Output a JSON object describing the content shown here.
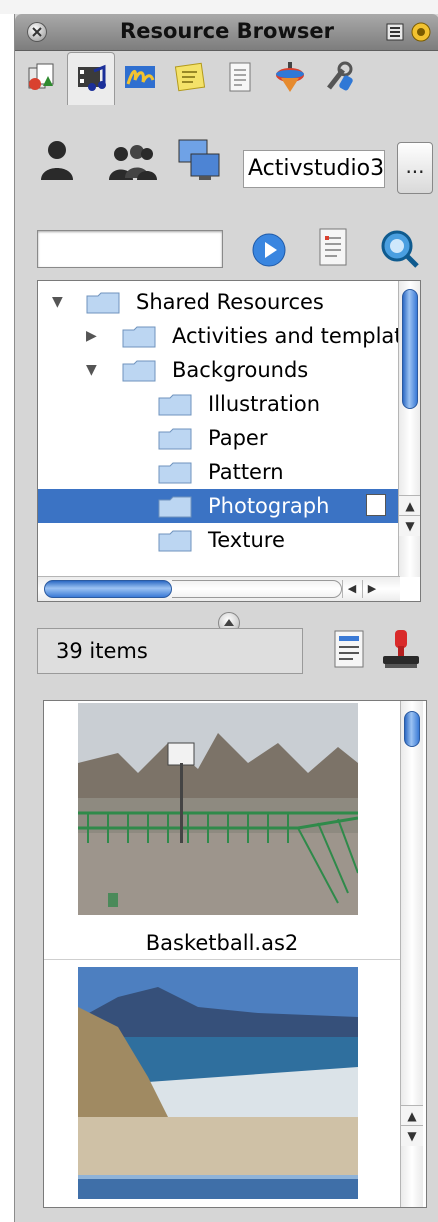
{
  "window": {
    "title": "Resource Browser"
  },
  "toolbar_tabs": [
    {
      "name": "resource-pack-tab",
      "icon": "shapes-icon"
    },
    {
      "name": "media-tab",
      "icon": "film-music-icon"
    },
    {
      "name": "handwriting-tab",
      "icon": "handwriting-icon"
    },
    {
      "name": "notes-tab",
      "icon": "sticky-note-icon"
    },
    {
      "name": "document-tab",
      "icon": "document-icon"
    },
    {
      "name": "spinner-tab",
      "icon": "spinning-top-icon"
    },
    {
      "name": "tools-tab",
      "icon": "tools-icon"
    }
  ],
  "user_bar": {
    "field_value": "Activstudio3",
    "ellipsis_label": "..."
  },
  "search": {
    "value": ""
  },
  "tree": {
    "rows": [
      {
        "label": "Shared Resources",
        "expanded": true
      },
      {
        "label": "Activities and templates",
        "expanded": false
      },
      {
        "label": "Backgrounds",
        "expanded": true
      },
      {
        "label": "Illustration"
      },
      {
        "label": "Paper"
      },
      {
        "label": "Pattern"
      },
      {
        "label": "Photograph",
        "selected": true
      },
      {
        "label": "Texture"
      }
    ]
  },
  "items_count": "39 items",
  "gallery": {
    "items": [
      {
        "label": "Basketball.as2"
      },
      {
        "label": ""
      }
    ]
  },
  "colors": {
    "selection": "#3b73c4",
    "panel": "#d6d6d6",
    "titlebar": "#8f8f8f"
  }
}
